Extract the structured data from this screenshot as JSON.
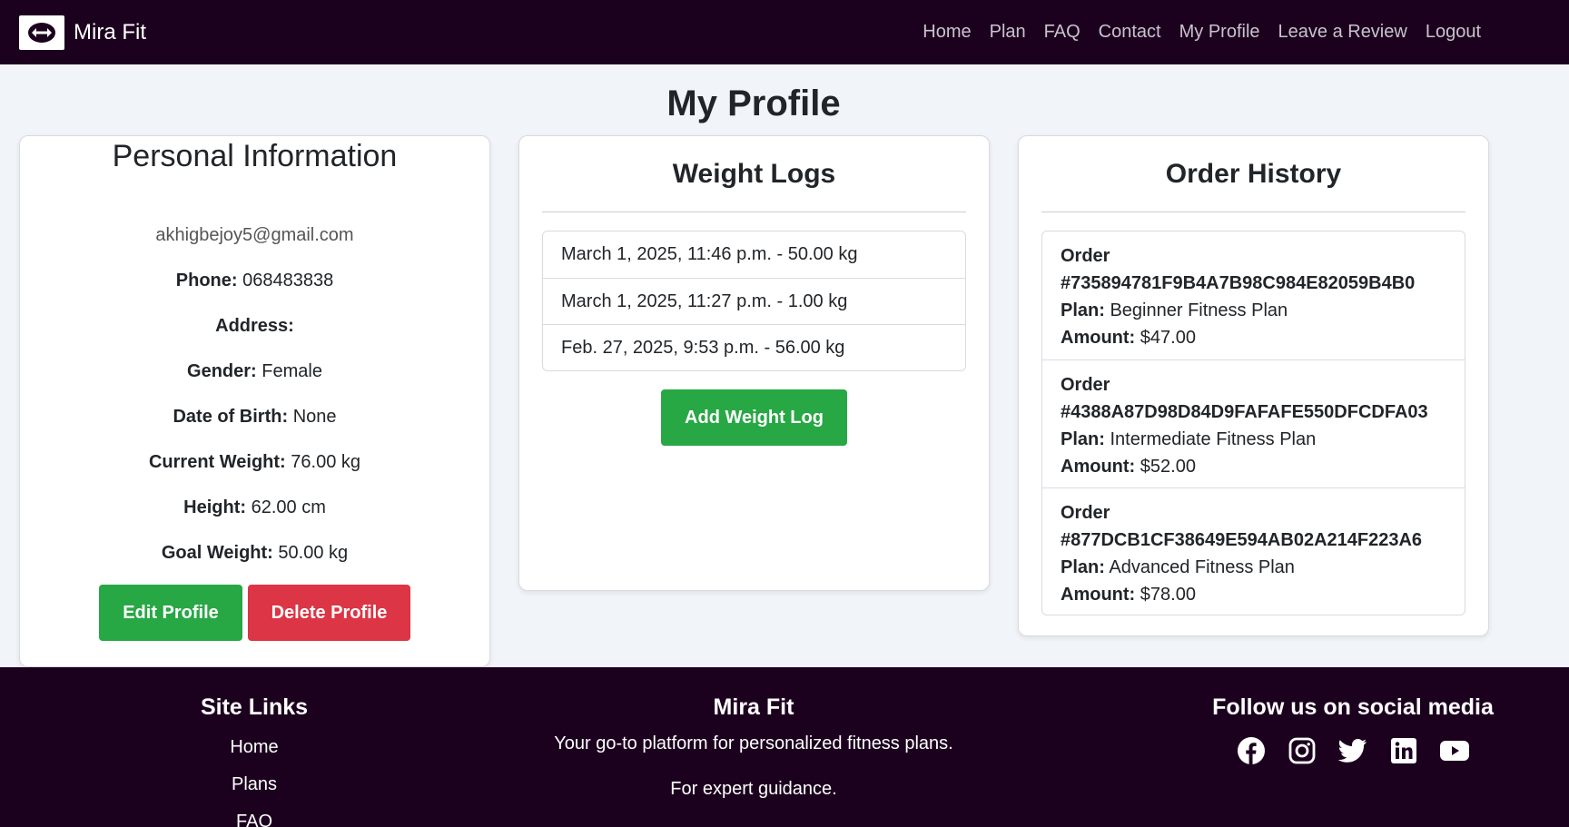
{
  "brand": {
    "name": "Mira Fit",
    "logo_icon": "dumbbell-icon"
  },
  "nav": {
    "items": [
      "Home",
      "Plan",
      "FAQ",
      "Contact",
      "My Profile",
      "Leave a Review",
      "Logout"
    ]
  },
  "page_title": "My Profile",
  "personal": {
    "title": "Personal Information",
    "email": "akhigbejoy5@gmail.com",
    "phone_label": "Phone:",
    "phone": "068483838",
    "address_label": "Address:",
    "address": "",
    "gender_label": "Gender:",
    "gender": "Female",
    "dob_label": "Date of Birth:",
    "dob": "None",
    "current_weight_label": "Current Weight:",
    "current_weight": "76.00 kg",
    "height_label": "Height:",
    "height": "62.00 cm",
    "goal_weight_label": "Goal Weight:",
    "goal_weight": "50.00 kg",
    "edit_label": "Edit Profile",
    "delete_label": "Delete Profile"
  },
  "weight_logs": {
    "title": "Weight Logs",
    "items": [
      "March 1, 2025, 11:46 p.m. - 50.00 kg",
      "March 1, 2025, 11:27 p.m. - 1.00 kg",
      "Feb. 27, 2025, 9:53 p.m. - 56.00 kg"
    ],
    "add_label": "Add Weight Log"
  },
  "orders": {
    "title": "Order History",
    "order_label": "Order",
    "plan_label": "Plan:",
    "amount_label": "Amount:",
    "items": [
      {
        "id": "#735894781F9B4A7B98C984E82059B4B0",
        "plan": "Beginner Fitness Plan",
        "amount": "$47.00"
      },
      {
        "id": "#4388A87D98D84D9FAFAFE550DFCDFA03",
        "plan": "Intermediate Fitness Plan",
        "amount": "$52.00"
      },
      {
        "id": "#877DCB1CF38649E594AB02A214F223A6",
        "plan": "Advanced Fitness Plan",
        "amount": "$78.00"
      }
    ]
  },
  "footer": {
    "links_title": "Site Links",
    "links": [
      "Home",
      "Plans",
      "FAQ"
    ],
    "about_title": "Mira Fit",
    "about_text": "Your go-to platform for personalized fitness plans.",
    "about_text2": "For expert guidance.",
    "social_title": "Follow us on social media",
    "social_icons": [
      "facebook-icon",
      "instagram-icon",
      "twitter-icon",
      "linkedin-icon",
      "youtube-icon"
    ]
  },
  "colors": {
    "nav_bg": "#1c011f",
    "green": "#28a745",
    "red": "#dc3545",
    "page_bg": "#f1f4f8"
  }
}
